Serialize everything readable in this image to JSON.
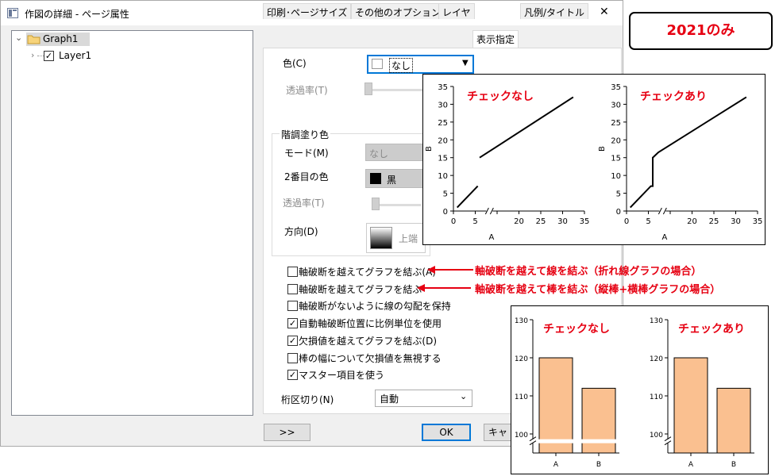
{
  "window": {
    "title": "作図の詳細 - ページ属性",
    "help": "?",
    "close": "✕"
  },
  "tree": {
    "root_label": "Graph1",
    "child_label": "Layer1"
  },
  "tabs": [
    "印刷･ページサイズ",
    "その他のオプション",
    "レイヤ",
    "表示指定",
    "凡例/タイトル"
  ],
  "display": {
    "color_label": "色(C)",
    "color_value": "なし",
    "transparency_label": "透過率(T)",
    "gradient_group_label": "階調塗り色",
    "mode_label": "モード(M)",
    "mode_value": "なし",
    "second_color_label": "2番目の色",
    "second_color_value": "黒",
    "transparency2_label": "透過率(T)",
    "direction_label": "方向(D)",
    "direction_value": "上端",
    "checkboxes": [
      {
        "label": "軸破断を越えてグラフを結ぶ(A)",
        "checked": false
      },
      {
        "label": "軸破断を越えてグラフを結ぶ",
        "checked": false
      },
      {
        "label": "軸破断がないように線の勾配を保持",
        "checked": false
      },
      {
        "label": "自動軸破断位置に比例単位を使用",
        "checked": true
      },
      {
        "label": "欠損値を越えてグラフを結ぶ(D)",
        "checked": true
      },
      {
        "label": "棒の幅について欠損値を無視する",
        "checked": false
      },
      {
        "label": "マスター項目を使う",
        "checked": true
      }
    ],
    "digit_sep_label": "桁区切り(N)",
    "digit_sep_value": "自動"
  },
  "buttons": {
    "expand": ">>",
    "ok": "OK",
    "cancel": "キャンセ"
  },
  "annotations": {
    "version_badge": "2021のみ",
    "note1": "軸破断を越えて線を結ぶ（折れ線グラフの場合）",
    "note2": "軸破断を越えて棒を結ぶ（縦棒+横棒グラフの場合）",
    "unchecked": "チェックなし",
    "checked": "チェックあり",
    "accent_color": "#e60012"
  },
  "chart_data": [
    {
      "type": "line",
      "title": "チェックなし",
      "xlabel": "A",
      "ylabel": "B",
      "xlim": [
        0,
        35
      ],
      "ylim": [
        0,
        35
      ],
      "xticks": [
        "0",
        "5",
        "",
        "20",
        "25",
        "30",
        "35"
      ],
      "yticks": [
        "0",
        "5",
        "10",
        "15",
        "20",
        "25",
        "30",
        "35"
      ],
      "segments": [
        [
          [
            1,
            1
          ],
          [
            6.5,
            7
          ]
        ],
        [
          [
            7,
            15
          ],
          [
            32,
            32
          ]
        ]
      ]
    },
    {
      "type": "line",
      "title": "チェックあり",
      "xlabel": "A",
      "ylabel": "B",
      "xlim": [
        0,
        35
      ],
      "ylim": [
        0,
        35
      ],
      "xticks": [
        "0",
        "5",
        "",
        "20",
        "25",
        "30",
        "35"
      ],
      "yticks": [
        "0",
        "5",
        "10",
        "15",
        "20",
        "25",
        "30",
        "35"
      ],
      "segments": [
        [
          [
            1,
            1
          ],
          [
            6.5,
            7
          ],
          [
            7,
            7
          ],
          [
            7,
            15
          ],
          [
            8.5,
            16.5
          ],
          [
            32,
            32
          ]
        ]
      ]
    },
    {
      "type": "bar",
      "title": "チェックなし",
      "categories": [
        "A",
        "B"
      ],
      "values": [
        120,
        112
      ],
      "yticks": [
        "130",
        "120",
        "110",
        "100"
      ],
      "ylim": [
        95,
        130
      ],
      "color": "#fac090",
      "connected": false
    },
    {
      "type": "bar",
      "title": "チェックあり",
      "categories": [
        "A",
        "B"
      ],
      "values": [
        120,
        112
      ],
      "yticks": [
        "130",
        "120",
        "110",
        "100"
      ],
      "ylim": [
        95,
        130
      ],
      "color": "#fac090",
      "connected": true
    }
  ]
}
